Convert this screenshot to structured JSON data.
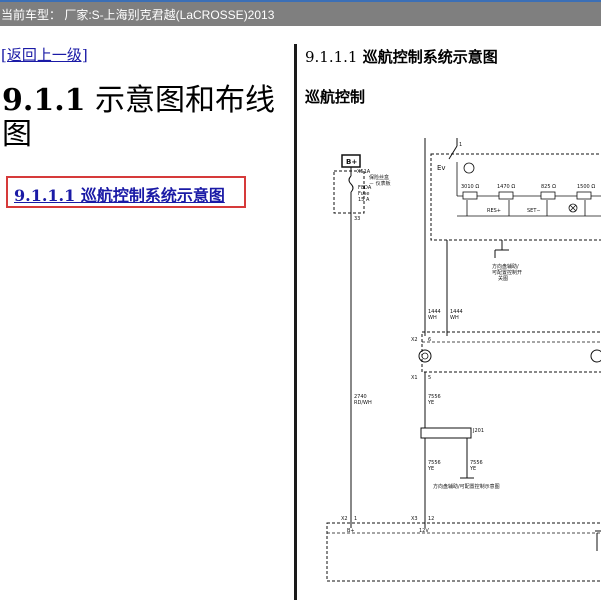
{
  "header": {
    "title": "当前车型： 厂家:S-上海别克君越(LaCROSSE)2013"
  },
  "left": {
    "back_link": "[返回上一级]",
    "page_title_number": "9.1.1",
    "page_title_text": " 示意图和布线图",
    "toc_link": "9.1.1.1 巡航控制系统示意图"
  },
  "right": {
    "section_number": "9.1.1.1",
    "section_title": " 巡航控制系统示意图",
    "diagram_subtitle": "巡航控制"
  },
  "diagram": {
    "b_plus": "B+",
    "fuse_header_1": "X51A",
    "fuse_header_2": "保险丝盒",
    "fuse_header_3": "－ 仪表板",
    "fuse_name": "F8DA",
    "fuse_label": "Fuse",
    "fuse_rating": "15 A",
    "pin_33": "33",
    "switch_pin_1": "1",
    "ev_label": "Ev",
    "resistor_1": "3010 Ω",
    "resistor_2": "1470 Ω",
    "resistor_3": "825 Ω",
    "resistor_4": "1500 Ω",
    "res_label": "RES+",
    "set_label": "SET−",
    "steering_ctrl_1": "方向盘辅助/",
    "steering_ctrl_2": "可配置控制开",
    "steering_ctrl_3": "关图",
    "wire_1444_a": "1444",
    "wire_wh_a": "WH",
    "wire_1444_b": "1444",
    "wire_wh_b": "WH",
    "connector_x2_top": "X2",
    "pin_6": "6",
    "connector_x1": "X1",
    "pin_5": "5",
    "wire_2740": "2740",
    "wire_rdwh": "RD/WH",
    "wire_7556_a": "7556",
    "wire_ye_a": "YE",
    "splice_j201": "J201",
    "wire_7556_b": "7556",
    "wire_ye_b": "YE",
    "wire_7556_c": "7556",
    "wire_ye_c": "YE",
    "steering_ctrl_bottom": "方向盘辅助/可配置控制示意图",
    "connector_x2_bottom": "X2",
    "pin_1_bottom": "1",
    "connector_x3": "X3",
    "pin_12": "12",
    "label_b_plus_bottom": "B+",
    "label_12v": "12V"
  }
}
